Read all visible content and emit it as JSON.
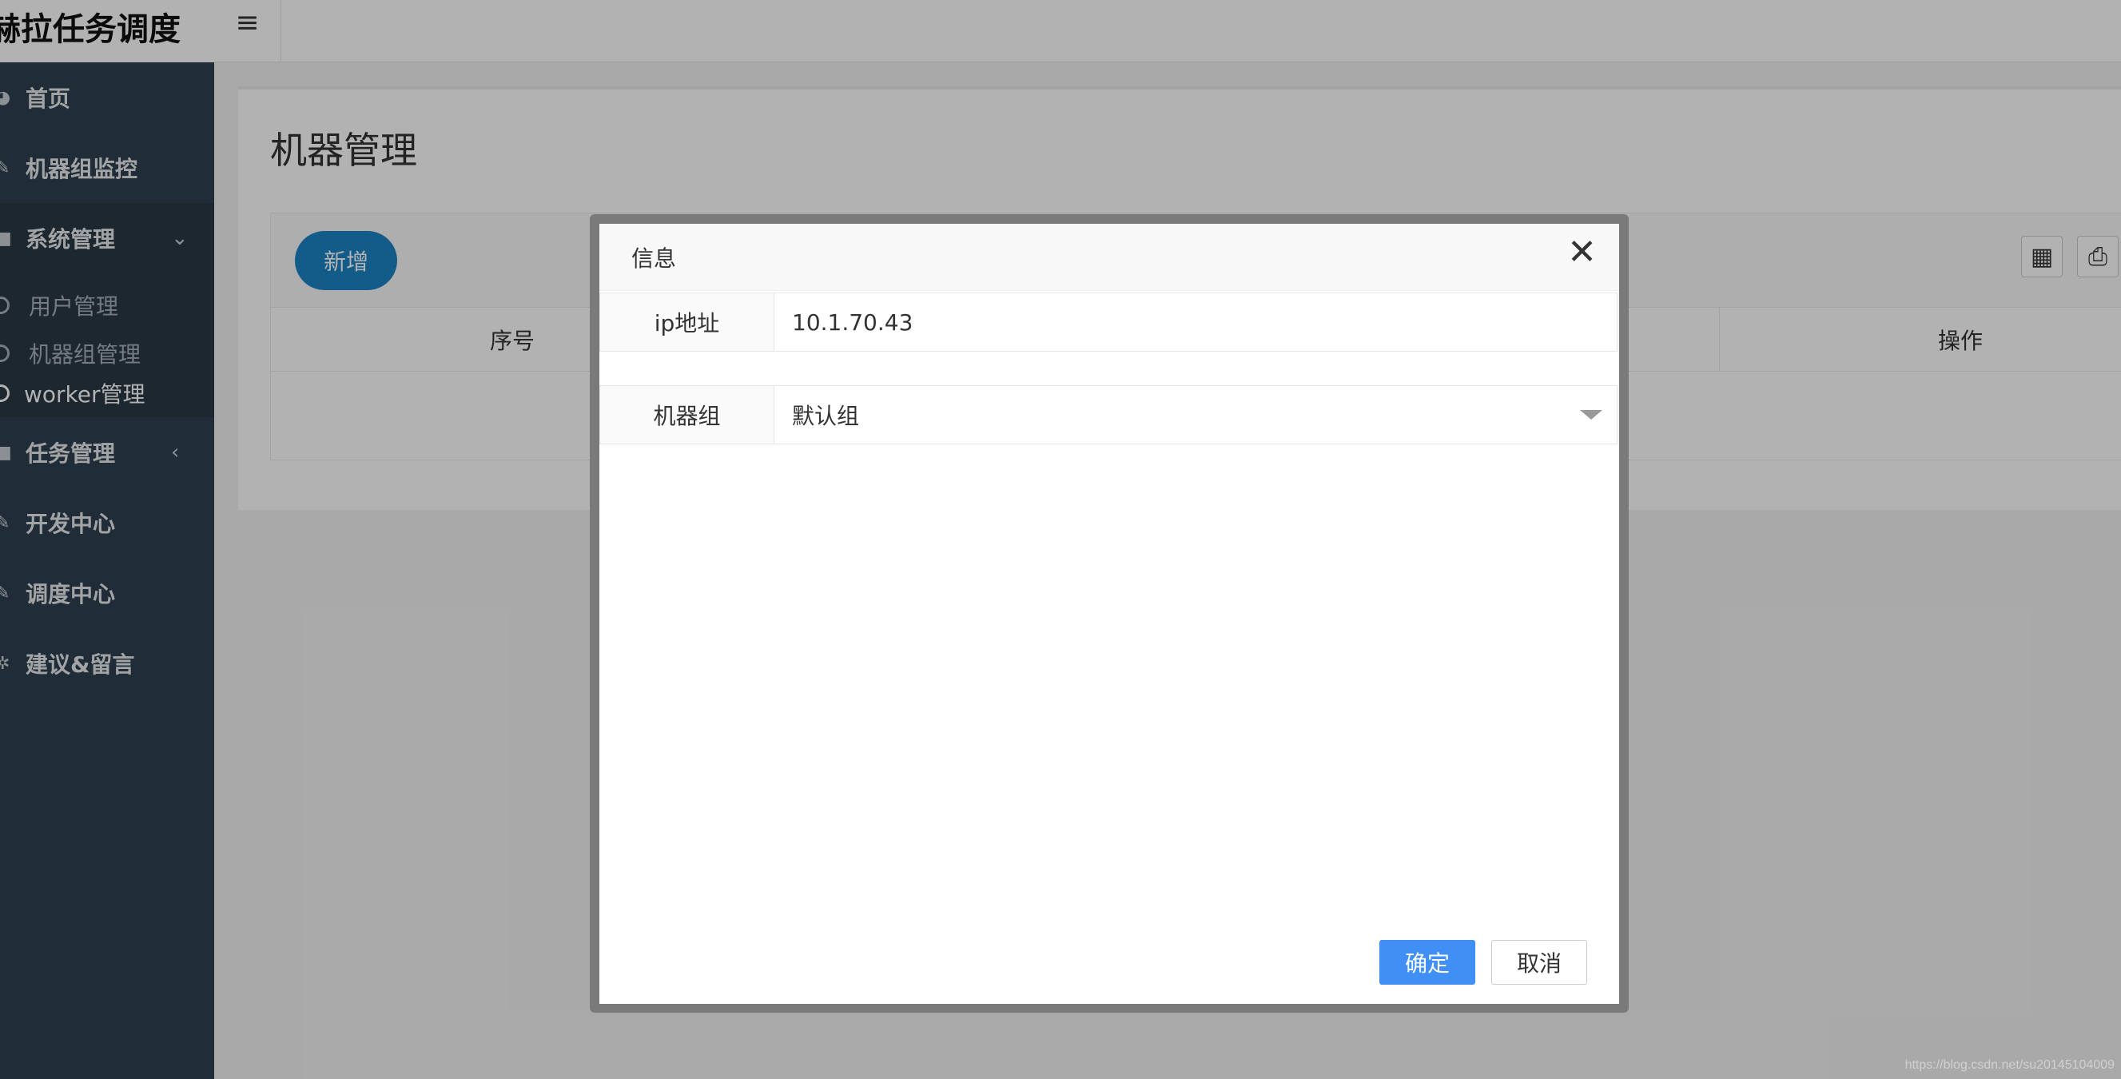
{
  "app": {
    "brand": "赫拉任务调度",
    "menu_toggle_icon": "hamburger-icon"
  },
  "sidebar": {
    "items": [
      {
        "label": "首页",
        "icon": "home-icon"
      },
      {
        "label": "机器组监控",
        "icon": "edit-icon"
      },
      {
        "label": "系统管理",
        "icon": "square-icon",
        "expanded": true
      },
      {
        "label": "任务管理",
        "icon": "square-icon"
      },
      {
        "label": "开发中心",
        "icon": "edit-icon"
      },
      {
        "label": "调度中心",
        "icon": "edit-icon"
      },
      {
        "label": "建议&留言",
        "icon": "gear-icon"
      }
    ],
    "submenu": [
      {
        "label": "用户管理"
      },
      {
        "label": "机器组管理"
      },
      {
        "label": "worker管理",
        "current": true
      }
    ]
  },
  "page": {
    "title": "机器管理",
    "add_button": "新增",
    "columns": [
      "序号",
      "操作"
    ]
  },
  "modal": {
    "title": "信息",
    "fields": [
      {
        "label": "ip地址",
        "value": "10.1.70.43"
      },
      {
        "label": "机器组",
        "value": "默认组"
      }
    ],
    "ok_label": "确定",
    "cancel_label": "取消"
  },
  "watermark": "https://blog.csdn.net/su20145104009",
  "colors": {
    "sidebar_bg": "#2f4050",
    "primary": "#1c84c6",
    "confirm": "#3f8ff5"
  }
}
